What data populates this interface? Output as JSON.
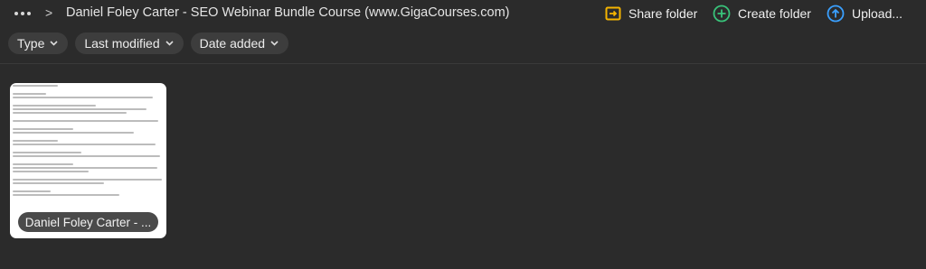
{
  "header": {
    "breadcrumb_separator": ">",
    "folder_title": "Daniel Foley Carter - SEO Webinar Bundle Course (www.GigaCourses.com)",
    "actions": {
      "share_label": "Share folder",
      "create_label": "Create folder",
      "upload_label": "Upload..."
    }
  },
  "filters": [
    {
      "label": "Type"
    },
    {
      "label": "Last modified"
    },
    {
      "label": "Date added"
    }
  ],
  "files": [
    {
      "name": "Daniel Foley Carter - ...",
      "kind": "document"
    }
  ],
  "colors": {
    "background": "#2b2b2b",
    "share_icon": "#f5b400",
    "create_icon": "#39c37a",
    "upload_icon": "#3aa0ff"
  },
  "icons": {
    "more": "more-horizontal-icon",
    "share": "share-folder-icon",
    "create": "plus-circle-icon",
    "upload": "upload-arrow-icon"
  }
}
